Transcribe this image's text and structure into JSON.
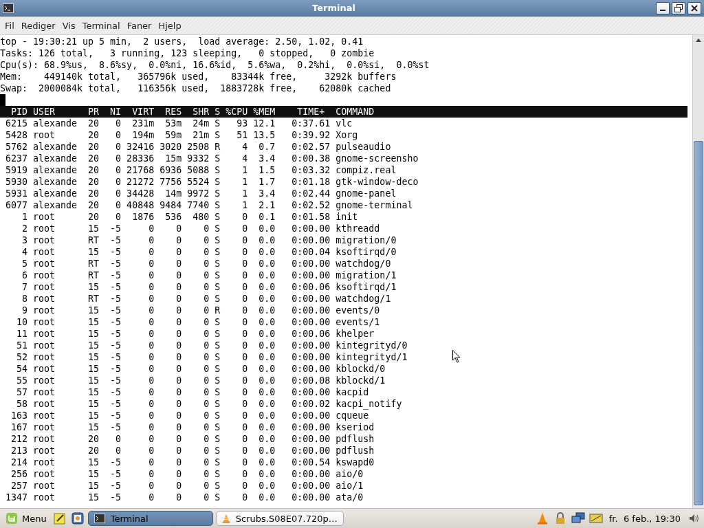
{
  "window": {
    "title": "Terminal"
  },
  "menu": [
    "Fil",
    "Rediger",
    "Vis",
    "Terminal",
    "Faner",
    "Hjelp"
  ],
  "summary": [
    "top - 19:30:21 up 5 min,  2 users,  load average: 2.50, 1.02, 0.41",
    "Tasks: 126 total,   3 running, 123 sleeping,   0 stopped,   0 zombie",
    "Cpu(s): 68.9%us,  8.6%sy,  0.0%ni, 16.6%id,  5.6%wa,  0.2%hi,  0.0%si,  0.0%st",
    "Mem:    449140k total,   365796k used,    83344k free,     3292k buffers",
    "Swap:  2000084k total,   116356k used,  1883728k free,    62080k cached"
  ],
  "table_header": "  PID USER      PR  NI  VIRT  RES  SHR S %CPU %MEM    TIME+  COMMAND",
  "rows": [
    " 6215 alexande  20   0  231m  53m  24m S   93 12.1   0:37.61 vlc",
    " 5428 root      20   0  194m  59m  21m S   51 13.5   0:39.92 Xorg",
    " 5762 alexande  20   0 32416 3020 2508 R    4  0.7   0:02.57 pulseaudio",
    " 6237 alexande  20   0 28336  15m 9332 S    4  3.4   0:00.38 gnome-screensho",
    " 5919 alexande  20   0 21768 6936 5088 S    1  1.5   0:03.32 compiz.real",
    " 5930 alexande  20   0 21272 7756 5524 S    1  1.7   0:01.18 gtk-window-deco",
    " 5931 alexande  20   0 34428  14m 9972 S    1  3.4   0:02.44 gnome-panel",
    " 6077 alexande  20   0 40848 9484 7740 S    1  2.1   0:02.52 gnome-terminal",
    "    1 root      20   0  1876  536  480 S    0  0.1   0:01.58 init",
    "    2 root      15  -5     0    0    0 S    0  0.0   0:00.00 kthreadd",
    "    3 root      RT  -5     0    0    0 S    0  0.0   0:00.00 migration/0",
    "    4 root      15  -5     0    0    0 S    0  0.0   0:00.04 ksoftirqd/0",
    "    5 root      RT  -5     0    0    0 S    0  0.0   0:00.00 watchdog/0",
    "    6 root      RT  -5     0    0    0 S    0  0.0   0:00.00 migration/1",
    "    7 root      15  -5     0    0    0 S    0  0.0   0:00.06 ksoftirqd/1",
    "    8 root      RT  -5     0    0    0 S    0  0.0   0:00.00 watchdog/1",
    "    9 root      15  -5     0    0    0 R    0  0.0   0:00.00 events/0",
    "   10 root      15  -5     0    0    0 S    0  0.0   0:00.00 events/1",
    "   11 root      15  -5     0    0    0 S    0  0.0   0:00.06 khelper",
    "   51 root      15  -5     0    0    0 S    0  0.0   0:00.00 kintegrityd/0",
    "   52 root      15  -5     0    0    0 S    0  0.0   0:00.00 kintegrityd/1",
    "   54 root      15  -5     0    0    0 S    0  0.0   0:00.00 kblockd/0",
    "   55 root      15  -5     0    0    0 S    0  0.0   0:00.08 kblockd/1",
    "   57 root      15  -5     0    0    0 S    0  0.0   0:00.00 kacpid",
    "   58 root      15  -5     0    0    0 S    0  0.0   0:00.02 kacpi_notify",
    "  163 root      15  -5     0    0    0 S    0  0.0   0:00.00 cqueue",
    "  167 root      15  -5     0    0    0 S    0  0.0   0:00.00 kseriod",
    "  212 root      20   0     0    0    0 S    0  0.0   0:00.00 pdflush",
    "  213 root      20   0     0    0    0 S    0  0.0   0:00.00 pdflush",
    "  214 root      15  -5     0    0    0 S    0  0.0   0:00.54 kswapd0",
    "  256 root      15  -5     0    0    0 S    0  0.0   0:00.00 aio/0",
    "  257 root      15  -5     0    0    0 S    0  0.0   0:00.00 aio/1",
    " 1347 root      15  -5     0    0    0 S    0  0.0   0:00.00 ata/0"
  ],
  "taskbar": {
    "menu_label": "Menu",
    "tasks": [
      {
        "label": "Terminal",
        "selected": true
      },
      {
        "label": "Scrubs.S08E07.720p…",
        "selected": false
      }
    ],
    "clock": "fr.  6 feb., 19:30"
  }
}
